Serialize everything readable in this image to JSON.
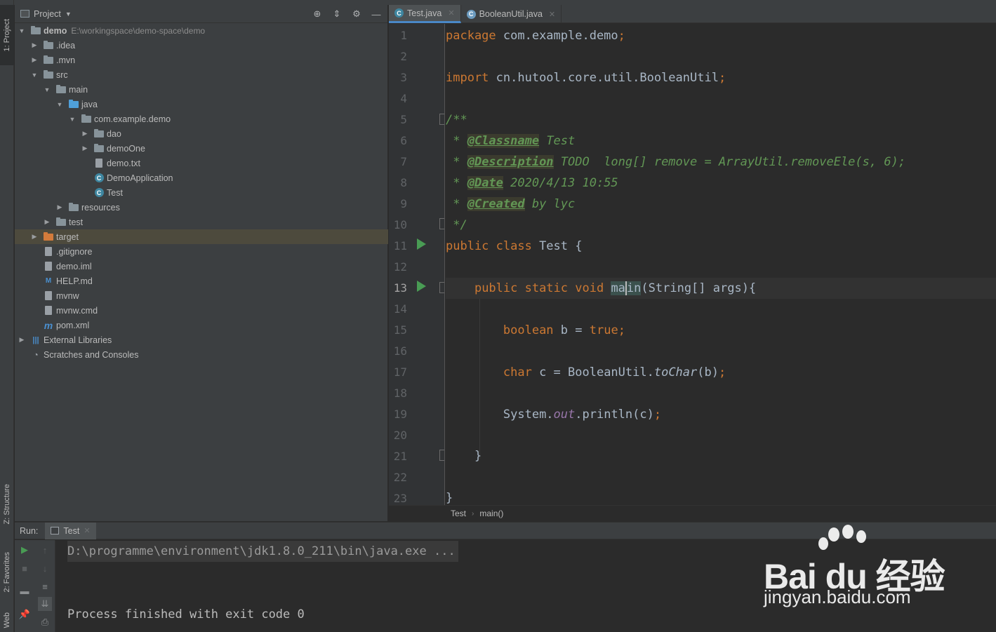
{
  "sidebar": {
    "project_tab": "1: Project",
    "structure_tab": "Z: Structure",
    "favorites_tab": "2: Favorites",
    "web_tab": "Web"
  },
  "project_panel": {
    "title": "Project",
    "tree": [
      {
        "label": "demo",
        "path": "E:\\workingspace\\demo-space\\demo",
        "depth": 0,
        "arrow": "down",
        "icon": "module-folder-icon",
        "bold": true
      },
      {
        "label": ".idea",
        "depth": 1,
        "arrow": "right",
        "icon": "folder-icon"
      },
      {
        "label": ".mvn",
        "depth": 1,
        "arrow": "right",
        "icon": "folder-icon"
      },
      {
        "label": "src",
        "depth": 1,
        "arrow": "down",
        "icon": "folder-icon"
      },
      {
        "label": "main",
        "depth": 2,
        "arrow": "down",
        "icon": "folder-icon"
      },
      {
        "label": "java",
        "depth": 3,
        "arrow": "down",
        "icon": "source-folder-icon"
      },
      {
        "label": "com.example.demo",
        "depth": 4,
        "arrow": "down",
        "icon": "package-icon"
      },
      {
        "label": "dao",
        "depth": 5,
        "arrow": "right",
        "icon": "package-icon"
      },
      {
        "label": "demoOne",
        "depth": 5,
        "arrow": "right",
        "icon": "package-icon"
      },
      {
        "label": "demo.txt",
        "depth": 5,
        "arrow": "",
        "icon": "text-file-icon"
      },
      {
        "label": "DemoApplication",
        "depth": 5,
        "arrow": "",
        "icon": "spring-class-icon"
      },
      {
        "label": "Test",
        "depth": 5,
        "arrow": "",
        "icon": "class-icon"
      },
      {
        "label": "resources",
        "depth": 3,
        "arrow": "right",
        "icon": "resources-folder-icon"
      },
      {
        "label": "test",
        "depth": 2,
        "arrow": "right",
        "icon": "folder-icon"
      },
      {
        "label": "target",
        "depth": 1,
        "arrow": "right",
        "icon": "excluded-folder-icon",
        "highlight": true
      },
      {
        "label": ".gitignore",
        "depth": 1,
        "arrow": "",
        "icon": "text-file-icon"
      },
      {
        "label": "demo.iml",
        "depth": 1,
        "arrow": "",
        "icon": "module-file-icon"
      },
      {
        "label": "HELP.md",
        "depth": 1,
        "arrow": "",
        "icon": "markdown-file-icon"
      },
      {
        "label": "mvnw",
        "depth": 1,
        "arrow": "",
        "icon": "text-file-icon"
      },
      {
        "label": "mvnw.cmd",
        "depth": 1,
        "arrow": "",
        "icon": "text-file-icon"
      },
      {
        "label": "pom.xml",
        "depth": 1,
        "arrow": "",
        "icon": "maven-icon"
      },
      {
        "label": "External Libraries",
        "depth": 0,
        "arrow": "right",
        "icon": "libraries-icon"
      },
      {
        "label": "Scratches and Consoles",
        "depth": 0,
        "arrow": "",
        "icon": "scratches-icon"
      }
    ]
  },
  "editor": {
    "tabs": [
      {
        "label": "Test.java",
        "active": true
      },
      {
        "label": "BooleanUtil.java",
        "active": false
      }
    ],
    "current_line": 13,
    "line_numbers": [
      "1",
      "2",
      "3",
      "4",
      "5",
      "6",
      "7",
      "8",
      "9",
      "10",
      "11",
      "12",
      "13",
      "14",
      "15",
      "16",
      "17",
      "18",
      "19",
      "20",
      "21",
      "22",
      "23"
    ],
    "breadcrumb": [
      "Test",
      "main()"
    ]
  },
  "code": {
    "l1_kw": "package",
    "l1_rest": " com.example.demo",
    "l3_kw": "import",
    "l3_rest": " cn.hutool.core.util.BooleanUtil",
    "l5": "/**",
    "l6_star": " * ",
    "l6_tag": "@Classname",
    "l6_rest": " Test",
    "l7_star": " * ",
    "l7_tag": "@Description",
    "l7_rest": " TODO  long[] remove = ArrayUtil.removeEle(s, 6);",
    "l8_star": " * ",
    "l8_tag": "@Date",
    "l8_rest": " 2020/4/13 10:55",
    "l9_star": " * ",
    "l9_tag": "@Created",
    "l9_rest": " by lyc",
    "l10": " */",
    "l11_kw": "public class",
    "l11_rest": " Test {",
    "l13_kw": "public static void",
    "l13_name_a": "ma",
    "l13_name_b": "in",
    "l13_rest": "(String[] args){",
    "l15_kw": "boolean",
    "l15_mid": " b = ",
    "l15_val": "true",
    "l17_kw": "char",
    "l17_mid": " c = BooleanUtil.",
    "l17_method": "toChar",
    "l17_arg": "(b)",
    "l19_a": "System.",
    "l19_field": "out",
    "l19_b": ".println(c)",
    "l21": "}",
    "l23": "}",
    "semicolon": ";"
  },
  "run_panel": {
    "label": "Run:",
    "tab": "Test",
    "command": "D:\\programme\\environment\\jdk1.8.0_211\\bin\\java.exe ...",
    "exit": "Process finished with exit code 0"
  },
  "watermark": {
    "logo": "Bai du 经验",
    "url": "jingyan.baidu.com"
  },
  "colors": {
    "keyword": "#cc7832",
    "doc": "#629755",
    "field": "#9876aa",
    "text": "#a9b7c6",
    "run_green": "#499c54",
    "tab_underline": "#4a88c7"
  }
}
